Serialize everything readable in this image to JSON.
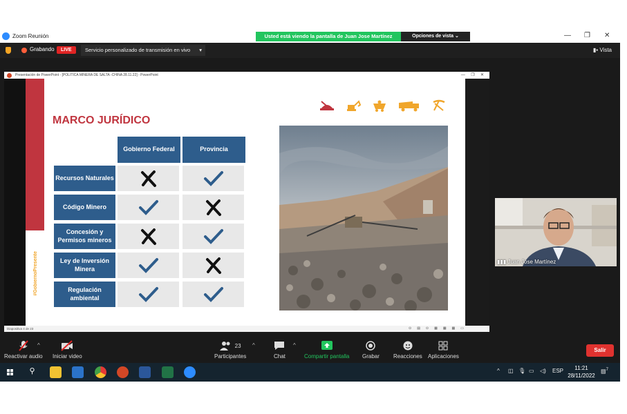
{
  "window": {
    "title": "Zoom Reunión",
    "share_banner": "Usted está viendo la pantalla de Juan Jose Martínez",
    "view_options": "Opciones de vista",
    "view_options_icon": "chevron-down-icon"
  },
  "top_toolbar": {
    "recording_label": "Grabando",
    "live_badge": "LIVE",
    "stream_menu": "Servicio personalizado de transmisión en vivo",
    "view_button": "Vista"
  },
  "ppt": {
    "window_title": "Presentación de PowerPoint - [POLITICA MINERA DE SALTA -CHINA 28.11.22] - PowerPoint",
    "status": "Diapositiva 4 de 23"
  },
  "slide": {
    "heading": "MARCO JURÍDICO",
    "hashtag": "#GobiernoPresente",
    "columns": [
      "Gobierno Federal",
      "Provincia"
    ],
    "rows": [
      {
        "label": "Recursos Naturales",
        "federal": "cross",
        "provincia": "check"
      },
      {
        "label": "Código Minero",
        "federal": "check",
        "provincia": "cross"
      },
      {
        "label": "Concesión y Permisos mineros",
        "federal": "cross",
        "provincia": "check"
      },
      {
        "label": "Ley de Inversión Minera",
        "federal": "check",
        "provincia": "cross"
      },
      {
        "label": "Regulación ambiental",
        "federal": "check",
        "provincia": "check"
      }
    ],
    "header_icons": [
      "helmet-icon",
      "excavator-icon",
      "mine-cart-icon",
      "truck-icon",
      "pickaxe-icon"
    ]
  },
  "participant": {
    "name": "Juan Jose Martínez"
  },
  "bottom_toolbar": {
    "audio": "Reactivar audio",
    "video": "Iniciar video",
    "participants": "Participantes",
    "participants_count": "23",
    "chat": "Chat",
    "share": "Compartir pantalla",
    "record": "Grabar",
    "reactions": "Reacciones",
    "apps": "Aplicaciones",
    "leave": "Salir"
  },
  "taskbar": {
    "language": "ESP",
    "time": "11:21",
    "date": "28/11/2022",
    "notification_count": "7"
  },
  "colors": {
    "accent_red": "#c0353f",
    "table_blue": "#2e5d8c",
    "share_green": "#22c55e",
    "icon_orange": "#f0a62c"
  }
}
